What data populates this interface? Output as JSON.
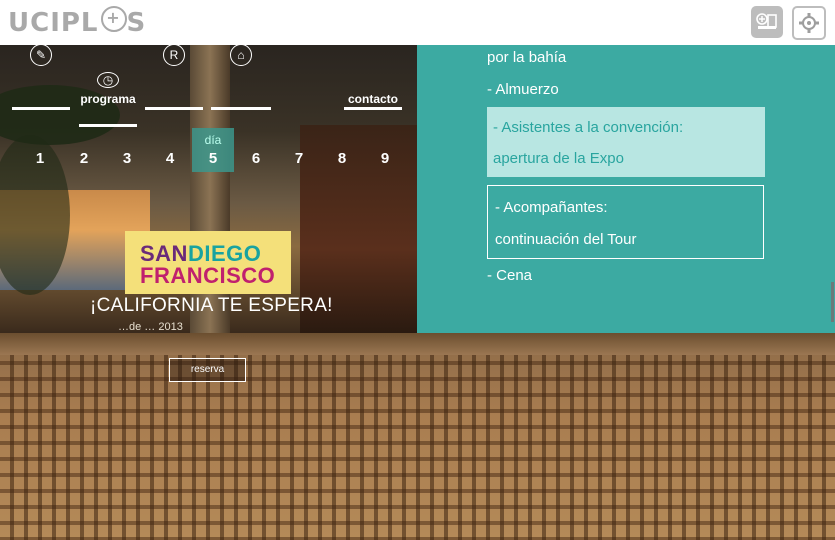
{
  "header": {
    "logo_text": "UCIPL",
    "logo_plus": "+",
    "logo_suffix": "S",
    "icons": [
      "add-window-icon",
      "settings-gear-icon"
    ]
  },
  "nav": {
    "items": [
      {
        "icon": "feather-icon",
        "label": ""
      },
      {
        "icon": "clock-icon",
        "label": "programa"
      },
      {
        "icon": "r-badge-icon",
        "label": ""
      },
      {
        "icon": "hotel-icon",
        "label": ""
      },
      {
        "icon": "",
        "label": "contacto"
      }
    ]
  },
  "days": {
    "label": "día",
    "numbers": [
      "1",
      "2",
      "3",
      "4",
      "5",
      "6",
      "7",
      "8",
      "9"
    ],
    "active": "5"
  },
  "brand": {
    "san": "SAN",
    "diego": "DIEGO",
    "francisco": "FRANCISCO",
    "tagline": "¡CALIFORNIA TE ESPERA!",
    "dates": "…de … 2013"
  },
  "schedule": {
    "line_bay": "por la bahía",
    "line_lunch": "- Almuerzo",
    "highlight_1": "- Asistentes a la convención:",
    "highlight_2": "apertura de la Expo",
    "outlined_1": "- Acompañantes:",
    "outlined_2": "continuación del Tour",
    "line_dinner": "- Cena"
  },
  "reserve_label": "reserva",
  "colors": {
    "teal": "#38b2ac",
    "brand_yellow": "#f4e07a",
    "brand_magenta": "#c0206e"
  }
}
